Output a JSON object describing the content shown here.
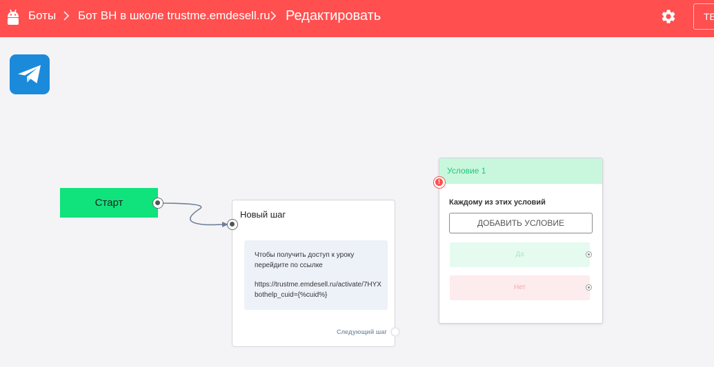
{
  "header": {
    "breadcrumbs": [
      {
        "label": "Боты"
      },
      {
        "label": "Бот ВН в школе trustme.emdesell.ru"
      },
      {
        "label": "Редактировать"
      }
    ],
    "right_button_label": "ТЕ",
    "icons": {
      "app": "bot-icon",
      "settings": "gear-icon",
      "separator": "chevron-right-icon"
    }
  },
  "canvas": {
    "channel_icon": "telegram-icon",
    "start_node": {
      "label": "Старт"
    },
    "step_node": {
      "title": "Новый шаг",
      "message_lines": [
        "Чтобы получить доступ к уроку",
        "перейдите по ссылке",
        "",
        "https://trustme.emdesell.ru/activate/7HYX",
        "bothelp_cuid={%cuid%}"
      ],
      "next_step_label": "Следующий шаг"
    },
    "condition_node": {
      "title": "Условие 1",
      "caption": "Каждому из этих условий",
      "add_button": "ДОБАВИТЬ УСЛОВИЕ",
      "yes_label": "Да",
      "no_label": "Нет",
      "error_mark": "!"
    }
  },
  "colors": {
    "header_bg": "#ff4f4f",
    "start_node": "#10e37b",
    "condition_header_bg": "#c9f7de",
    "condition_header_text": "#1fc77a",
    "yes_bg": "#e6fbef",
    "no_bg": "#fdeced",
    "telegram": "#1c8adb",
    "connector": "#6f7e9b"
  }
}
